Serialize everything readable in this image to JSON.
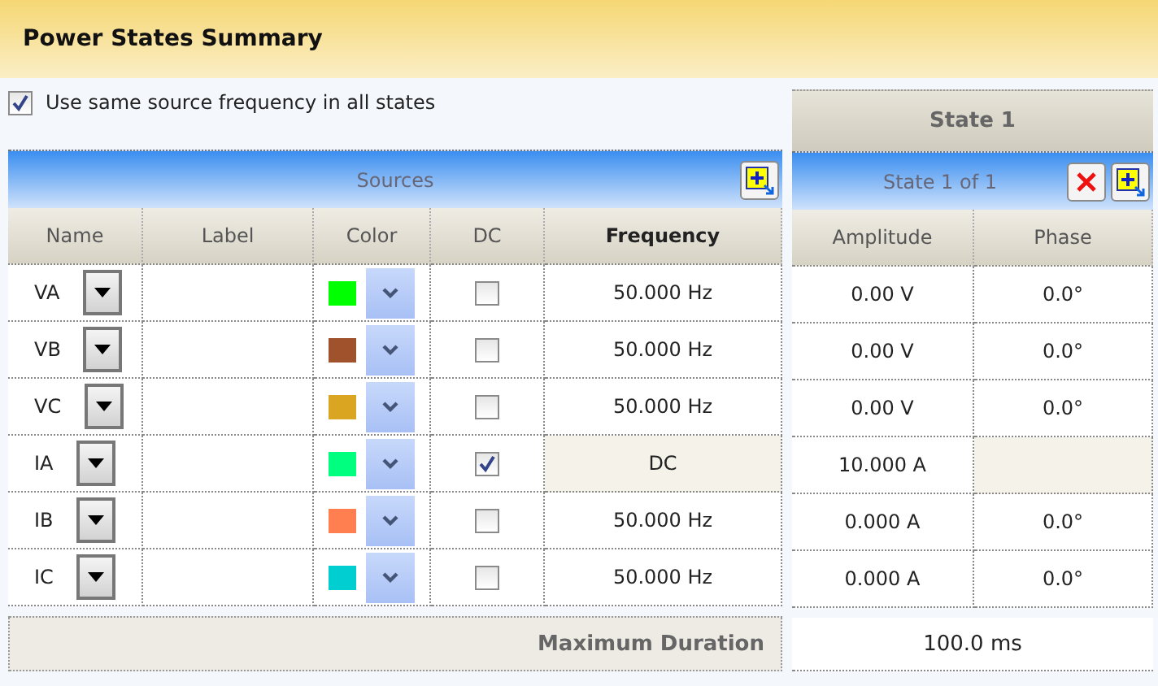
{
  "title": "Power States Summary",
  "same_frequency": {
    "label": "Use same source frequency in all states",
    "checked": true
  },
  "sources": {
    "title": "Sources",
    "columns": [
      "Name",
      "Label",
      "Color",
      "DC",
      "Frequency"
    ]
  },
  "state": {
    "title": "State 1",
    "subtitle": "State 1 of 1",
    "columns": [
      "Amplitude",
      "Phase"
    ]
  },
  "rows": [
    {
      "name": "VA",
      "color": "#00ff00",
      "dc": false,
      "frequency": "50.000 Hz",
      "amplitude": "0.00 V",
      "phase": "0.0°"
    },
    {
      "name": "VB",
      "color": "#a0522d",
      "dc": false,
      "frequency": "50.000 Hz",
      "amplitude": "0.00 V",
      "phase": "0.0°"
    },
    {
      "name": "VC",
      "color": "#daa520",
      "dc": false,
      "frequency": "50.000 Hz",
      "amplitude": "0.00 V",
      "phase": "0.0°"
    },
    {
      "name": "IA",
      "color": "#00ff7f",
      "dc": true,
      "frequency": "DC",
      "amplitude": "10.000 A"
    },
    {
      "name": "IB",
      "color": "#ff7f50",
      "dc": false,
      "frequency": "50.000 Hz",
      "amplitude": "0.000 A",
      "phase": "0.0°"
    },
    {
      "name": "IC",
      "color": "#00ced1",
      "dc": false,
      "frequency": "50.000 Hz",
      "amplitude": "0.000 A",
      "phase": "0.0°"
    }
  ],
  "max_duration": {
    "label": "Maximum Duration",
    "value": "100.0 ms"
  }
}
